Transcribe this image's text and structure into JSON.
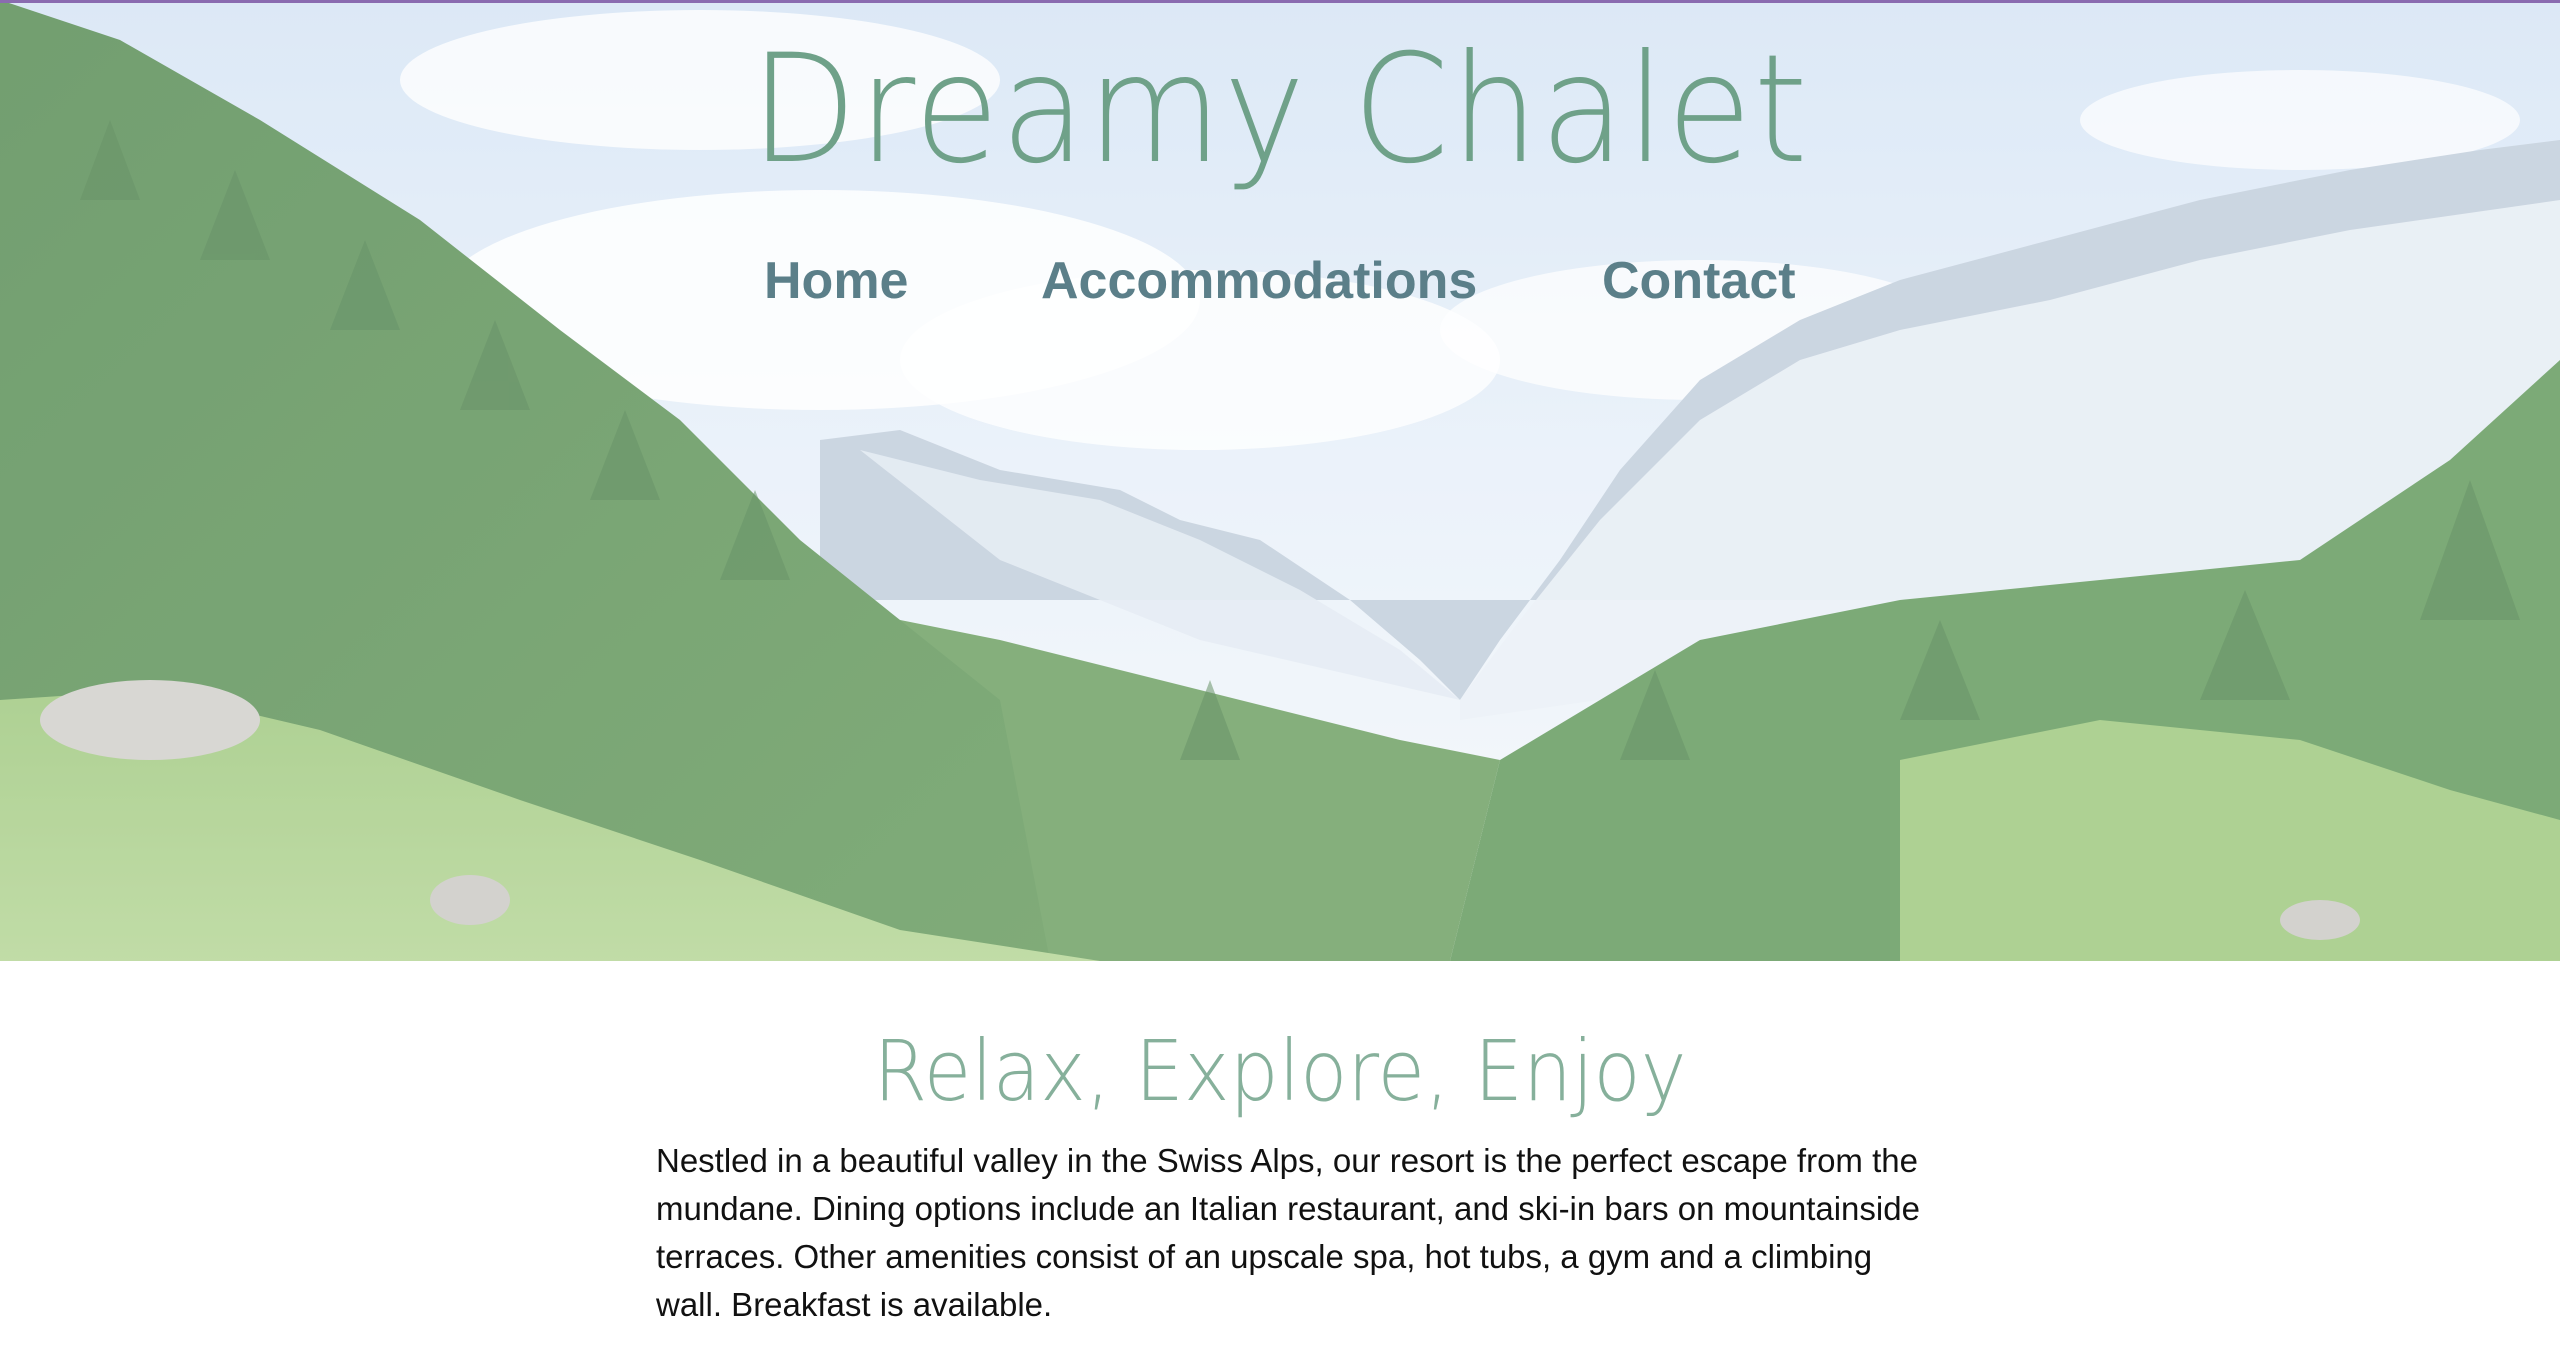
{
  "header": {
    "site_title": "Dreamy Chalet",
    "nav": {
      "home": "Home",
      "accommodations": "Accommodations",
      "contact": "Contact"
    }
  },
  "hero": {
    "image": "alpine-valley-photo"
  },
  "main": {
    "tagline": "Relax, Explore, Enjoy",
    "description": "Nestled in a beautiful valley in the Swiss Alps, our resort is the perfect escape from the mundane. Dining options include an Italian restaurant, and ski-in bars on mountainside terraces. Other amenities consist of an upscale spa, hot tubs, a gym and a climbing wall. Breakfast is available."
  },
  "colors": {
    "title": "#6fa189",
    "nav": "#5b7f89",
    "tagline": "#86b09b",
    "body_text": "#111111",
    "accent_line": "#8a6bb0"
  }
}
